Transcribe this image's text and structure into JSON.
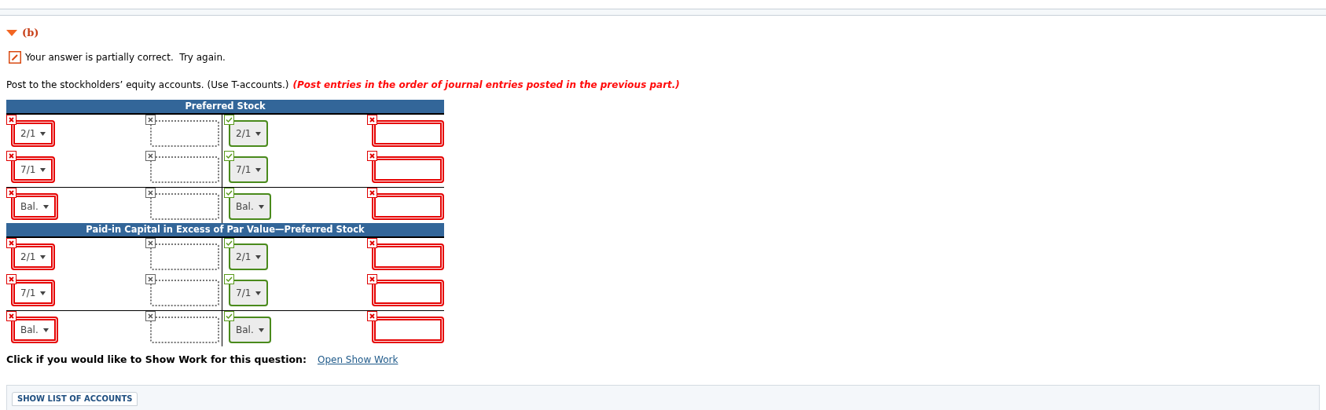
{
  "part": {
    "label": "(b)",
    "expanded": true
  },
  "feedback": {
    "text": "Your answer is partially correct.  Try again."
  },
  "instruction": {
    "text": "Post to the stockholders’ equity accounts. (Use T-accounts.)",
    "note": "(Post entries in the order of journal entries posted in the previous part.)"
  },
  "accounts": [
    {
      "title": "Preferred Stock",
      "rows": [
        {
          "kind": "entry",
          "debit_date": {
            "value": "2/1",
            "graded": true,
            "correct": false
          },
          "debit_amount": {
            "graded": false
          },
          "credit_date": {
            "value": "2/1",
            "graded": true,
            "correct": true
          },
          "credit_amount": {
            "graded": true,
            "correct": false
          }
        },
        {
          "kind": "entry",
          "debit_date": {
            "value": "7/1",
            "graded": true,
            "correct": false
          },
          "debit_amount": {
            "graded": false
          },
          "credit_date": {
            "value": "7/1",
            "graded": true,
            "correct": true
          },
          "credit_amount": {
            "graded": true,
            "correct": false
          }
        },
        {
          "kind": "balance",
          "debit_date": {
            "value": "Bal.",
            "graded": true,
            "correct": false
          },
          "debit_amount": {
            "graded": false
          },
          "credit_date": {
            "value": "Bal.",
            "graded": true,
            "correct": true
          },
          "credit_amount": {
            "graded": true,
            "correct": false
          }
        }
      ]
    },
    {
      "title": "Paid-in Capital in Excess of Par Value—Preferred Stock",
      "rows": [
        {
          "kind": "entry",
          "debit_date": {
            "value": "2/1",
            "graded": true,
            "correct": false
          },
          "debit_amount": {
            "graded": false
          },
          "credit_date": {
            "value": "2/1",
            "graded": true,
            "correct": true
          },
          "credit_amount": {
            "graded": true,
            "correct": false
          }
        },
        {
          "kind": "entry",
          "debit_date": {
            "value": "7/1",
            "graded": true,
            "correct": false
          },
          "debit_amount": {
            "graded": false
          },
          "credit_date": {
            "value": "7/1",
            "graded": true,
            "correct": true
          },
          "credit_amount": {
            "graded": true,
            "correct": false
          }
        },
        {
          "kind": "balance",
          "debit_date": {
            "value": "Bal.",
            "graded": true,
            "correct": false
          },
          "debit_amount": {
            "graded": false
          },
          "credit_date": {
            "value": "Bal.",
            "graded": true,
            "correct": true
          },
          "credit_amount": {
            "graded": true,
            "correct": false
          }
        }
      ]
    }
  ],
  "show_work": {
    "label": "Click if you would like to Show Work for this question:",
    "link": "Open Show Work"
  },
  "accounts_button": "SHOW LIST OF ACCOUNTS"
}
